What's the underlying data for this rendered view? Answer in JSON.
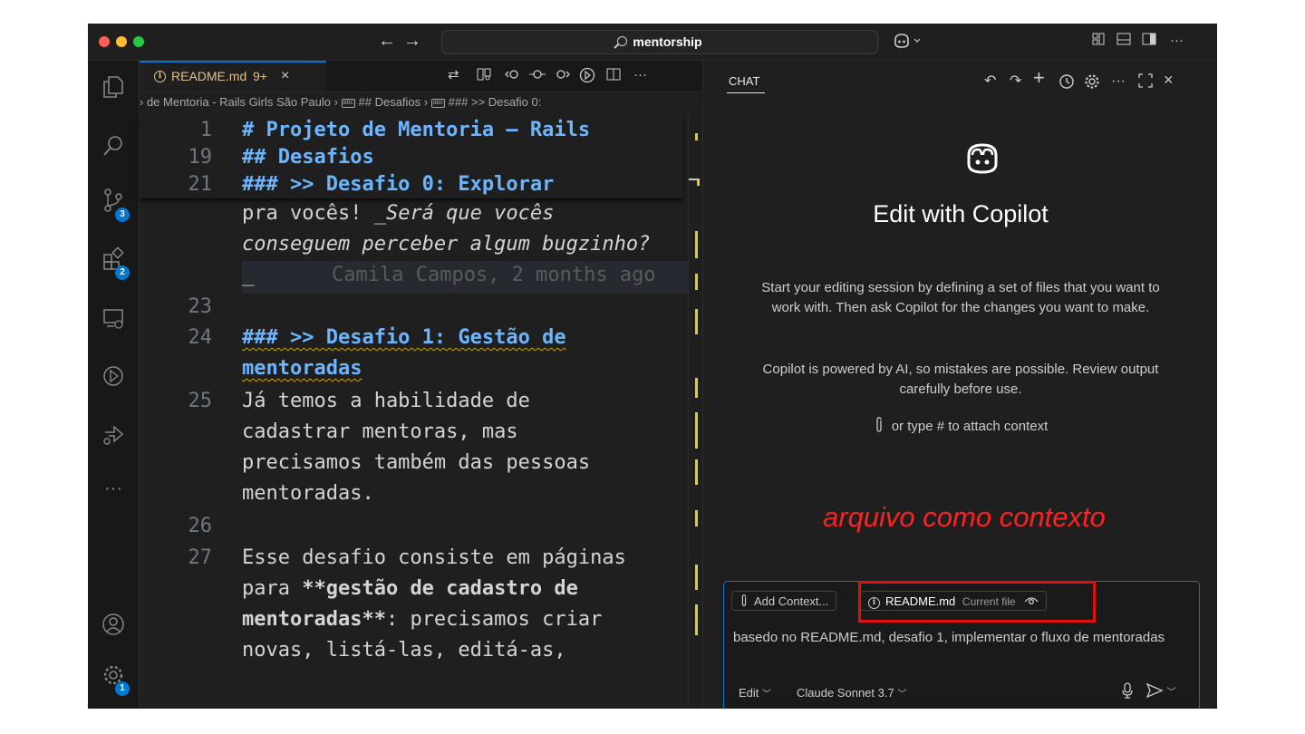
{
  "titlebar": {
    "search_text": "mentorship",
    "back_arrow": "←",
    "forward_arrow": "→",
    "traffic_lights": [
      "#ff5f57",
      "#febc2e",
      "#28c840"
    ]
  },
  "activity": {
    "source_control_badge": "3",
    "extensions_badge": "2",
    "settings_badge": "1",
    "more_label": "···"
  },
  "editor": {
    "tab": {
      "filename": "README.md",
      "problems": "9+",
      "close": "×"
    },
    "breadcrumb": {
      "part1": "› de Mentoria - Rails Girls São Paulo",
      "sep": "›",
      "part2": "## Desafios",
      "part3": "### >> Desafio 0:"
    },
    "sticky": [
      {
        "line": "1",
        "text": "# Projeto de Mentoria – Rails"
      },
      {
        "line": "19",
        "text": "## Desafios"
      },
      {
        "line": "21",
        "text": "### >> Desafio 0: Explorar"
      }
    ],
    "lines": {
      "l22a_pre": "pra vocês! ",
      "l22a_it": "_Será que vocês",
      "l22b_it": "conseguem perceber algum bugzinho?",
      "l22c_it": "_",
      "blame": "Camila Campos, 2 months ago",
      "n23": "23",
      "n24": "24",
      "l24a": "### >> Desafio 1: Gestão de",
      "l24b": "mentoradas",
      "n25": "25",
      "l25a": "Já temos a habilidade de",
      "l25b": "cadastrar mentoras, mas",
      "l25c": "precisamos também das pessoas",
      "l25d": "mentoradas.",
      "n26": "26",
      "n27": "27",
      "l27a": "Esse desafio consiste em páginas",
      "l27b_pre": "para ",
      "l27b_b": "**gestão de cadastro de",
      "l27c_b": "mentoradas**",
      "l27c_post": ": precisamos criar",
      "l27d": "novas, listá-las, editá-as,"
    }
  },
  "chat": {
    "tab_label": "CHAT",
    "title": "Edit with Copilot",
    "desc": "Start your editing session by defining a set of files that you want to work with. Then ask Copilot for the changes you want to make.",
    "disclaimer": "Copilot is powered by AI, so mistakes are possible. Review output carefully before use.",
    "attach_hint": "or type # to attach context",
    "annotation": "arquivo como contexto",
    "input": {
      "add_context": "Add Context...",
      "file_chip": "README.md",
      "file_chip_sub": "Current file",
      "text": "basedo no README.md, desafio 1, implementar o fluxo de mentoradas",
      "mode": "Edit",
      "model": "Claude Sonnet 3.7"
    }
  }
}
